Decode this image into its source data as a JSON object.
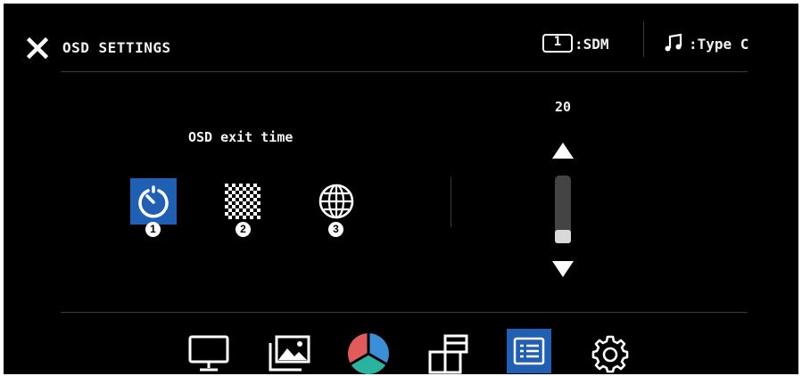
{
  "header": {
    "title": "OSD SETTINGS",
    "input_number": "1",
    "input_label": ":SDM",
    "audio_label": ":Type C"
  },
  "main": {
    "section_label": "OSD exit time",
    "options": [
      {
        "icon": "timer-icon",
        "badge": "1",
        "selected": true
      },
      {
        "icon": "checkerboard-icon",
        "badge": "2",
        "selected": false
      },
      {
        "icon": "globe-icon",
        "badge": "3",
        "selected": false
      }
    ]
  },
  "slider": {
    "value": "20",
    "level_percent": 20
  },
  "bottom_tabs": [
    {
      "icon": "monitor-icon",
      "selected": false
    },
    {
      "icon": "image-icon",
      "selected": false
    },
    {
      "icon": "color-icon",
      "selected": false
    },
    {
      "icon": "pip-icon",
      "selected": false
    },
    {
      "icon": "osd-menu-icon",
      "selected": true
    },
    {
      "icon": "gear-icon",
      "selected": false
    }
  ],
  "colors": {
    "accent": "#1f5fb4",
    "background": "#000000",
    "text": "#f2f2f2",
    "divider": "#3a3a3a"
  }
}
